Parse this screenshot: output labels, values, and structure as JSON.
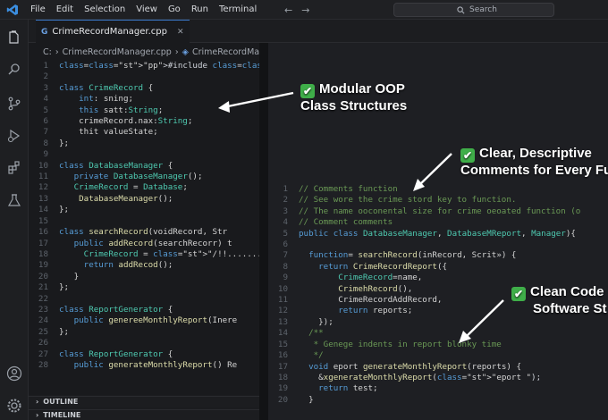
{
  "menu": [
    "File",
    "Edit",
    "Selection",
    "View",
    "Go",
    "Run",
    "Terminal"
  ],
  "search": {
    "label": "Search"
  },
  "tab": {
    "title": "CrimeRecordManager.cpp"
  },
  "breadcrumb": {
    "root": "C:",
    "file1": "CrimeRecordManager.cpp",
    "file2": "CrimeRecordManager.cpp"
  },
  "left_code": [
    {
      "n": "1",
      "t": "#include <crimenecord.d.h>"
    },
    {
      "n": "2",
      "t": ""
    },
    {
      "n": "3",
      "t": "class CrimeRecord {"
    },
    {
      "n": "4",
      "t": "    int: sning;"
    },
    {
      "n": "5",
      "t": "    this satt:String;"
    },
    {
      "n": "6",
      "t": "    crimeRecord.nax:String;"
    },
    {
      "n": "7",
      "t": "    thit valueState;"
    },
    {
      "n": "8",
      "t": "};"
    },
    {
      "n": "9",
      "t": ""
    },
    {
      "n": "10",
      "t": "class DatabaseManager {"
    },
    {
      "n": "11",
      "t": "   private DatabaseManager();"
    },
    {
      "n": "12",
      "t": "   CrimeRecord = Database;"
    },
    {
      "n": "13",
      "t": "    DatabaseMeanager();"
    },
    {
      "n": "14",
      "t": "};"
    },
    {
      "n": "15",
      "t": ""
    },
    {
      "n": "16",
      "t": "class searchRecord(voidRecord, Str"
    },
    {
      "n": "17",
      "t": "   public addRecord(searchRecorr) t"
    },
    {
      "n": "18",
      "t": "     CrimeRecord = \"/!!............"
    },
    {
      "n": "19",
      "t": "     return addRecod();"
    },
    {
      "n": "20",
      "t": "   }"
    },
    {
      "n": "21",
      "t": "};"
    },
    {
      "n": "22",
      "t": ""
    },
    {
      "n": "23",
      "t": "class ReportGenerator {"
    },
    {
      "n": "24",
      "t": "   public genereeMonthlyReport(Inere"
    },
    {
      "n": "25",
      "t": "};"
    },
    {
      "n": "26",
      "t": ""
    },
    {
      "n": "27",
      "t": "class ReportGenerator {"
    },
    {
      "n": "28",
      "t": "   public generateMonthlyReport() Re"
    }
  ],
  "right_code": [
    {
      "n": "1",
      "t": "// Comments function"
    },
    {
      "n": "2",
      "t": "// See wore the crime stord key to function."
    },
    {
      "n": "3",
      "t": "// The name ooconental size for crime oeoated function (o"
    },
    {
      "n": "4",
      "t": "// Comment comments"
    },
    {
      "n": "5",
      "t": "public class DatabaseManager, DatabaseMReport, Manager){"
    },
    {
      "n": "6",
      "t": ""
    },
    {
      "n": "7",
      "t": "  function= searchRecord(inRecord, Scrit») {"
    },
    {
      "n": "8",
      "t": "    return CrimeRecordReport({"
    },
    {
      "n": "9",
      "t": "        CrimeRecord=name,"
    },
    {
      "n": "10",
      "t": "        CrimehRecord(),"
    },
    {
      "n": "11",
      "t": "        CrimeRecordAddRecord,"
    },
    {
      "n": "12",
      "t": "        return reports;"
    },
    {
      "n": "13",
      "t": "    });"
    },
    {
      "n": "14",
      "t": "  /**"
    },
    {
      "n": "15",
      "t": "   * Genege indents in report blonky time"
    },
    {
      "n": "16",
      "t": "   */"
    },
    {
      "n": "17",
      "t": "  void eport generateMonthlyReport(reports) {"
    },
    {
      "n": "18",
      "t": "    &xgenerateMonthlyReport(\"eport \");"
    },
    {
      "n": "19",
      "t": "    return test;"
    },
    {
      "n": "20",
      "t": "  }"
    }
  ],
  "panels": {
    "outline": "OUTLINE",
    "timeline": "TIMELINE"
  },
  "callouts": {
    "oop_line1": "Modular OOP",
    "oop_line2": "Class Structures",
    "comments_line1": "Clear, Descriptive",
    "comments_line2": "Comments for Every Fu",
    "clean_line1": "Clean Code",
    "clean_line2": "Software St"
  },
  "colors": {
    "accent": "#3a78c8",
    "check": "#3fae49",
    "background": "#1b1c1f"
  }
}
